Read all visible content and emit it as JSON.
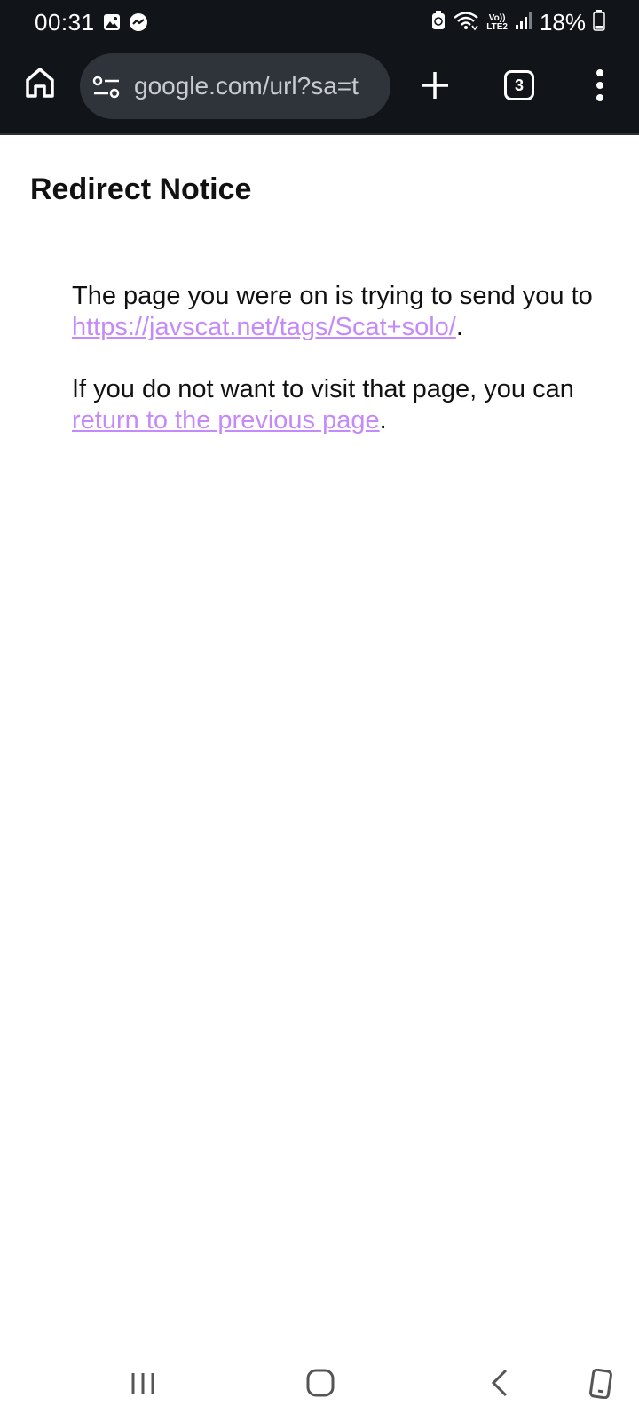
{
  "status_bar": {
    "time": "00:31",
    "battery": "18%",
    "volte_line1": "Vo))",
    "volte_line2": "LTE2",
    "icons": [
      "gallery-icon",
      "messenger-icon",
      "battery-saver-icon",
      "wifi-icon",
      "volte-icon",
      "signal-icon",
      "battery-icon"
    ]
  },
  "toolbar": {
    "url": "google.com/url?sa=t",
    "tab_count": "3",
    "icons": [
      "home-icon",
      "page-info-icon",
      "plus-icon",
      "tab-switcher-icon",
      "overflow-menu-icon"
    ]
  },
  "page": {
    "title": "Redirect Notice",
    "para1_text": " The page you were on is trying to send you to ",
    "para1_link": "https://javscat.net/tags/Scat+solo/",
    "para1_end": ".",
    "para2_text": " If you do not want to visit that page, you can ",
    "para2_link": "return to the previous page",
    "para2_end": "."
  },
  "nav_bar": {
    "icons": [
      "recents-icon",
      "home-icon",
      "back-icon",
      "keyboard-toggle-icon"
    ]
  },
  "colors": {
    "chrome_bg": "#111419",
    "url_bar_bg": "#2f343b",
    "link": "#c58af9"
  }
}
